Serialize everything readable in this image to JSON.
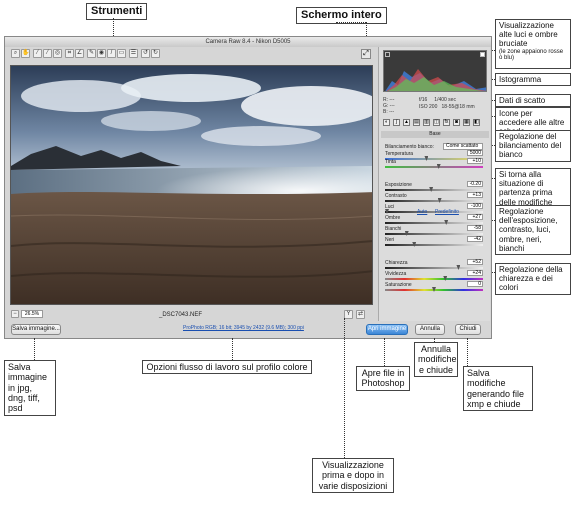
{
  "callouts": {
    "strumenti": "Strumenti",
    "schermo": "Schermo intero",
    "alte_luci": "Visualizzazione alte luci e ombre bruciate",
    "alte_luci_note": "(le zone appaiono rosse o blu)",
    "istogramma": "Istogramma",
    "dati_scatto": "Dati di scatto",
    "icone": "Icone per accedere alle altre schede",
    "bilanciamento": "Regolazione del bilanciamento del bianco",
    "torna": "Si torna alla situazione di partenza prima delle modifiche",
    "esposizione": "Regolazione dell'esposizione, contrasto, luci, ombre, neri, bianchi",
    "chiarezza": "Regolazione della chiarezza e dei colori",
    "salva": "Salva immagine in jpg, dng, tiff, psd",
    "opzioni": "Opzioni flusso di lavoro sul profilo colore",
    "apre": "Apre file in Photoshop",
    "annulla": "Annulla modifiche e chiude",
    "salva_mod": "Salva modifiche generando file xmp e chiude",
    "prima_dopo": "Visualizzazione prima e dopo in varie disposizioni"
  },
  "window": {
    "title": "Camera Raw 8.4  -  Nikon D5005",
    "zoom": "26.5%",
    "filename": "_DSC7043.NEF",
    "workflow": "ProPhoto RGB; 16 bit; 3945 by 2432 (9.6 MB); 300 ppi",
    "save_button": "Salva immagine...",
    "open_button": "Apri immagine",
    "cancel_button": "Annulla",
    "done_button": "Chiudi"
  },
  "panel": {
    "rgb": [
      "R:",
      "G:",
      "B:"
    ],
    "rgb_values": [
      "---",
      "---",
      "---"
    ],
    "shot_line1": "f/16     1/400 sec",
    "shot_line2": "ISO 200   18-55@18 mm",
    "section": "Base",
    "wb_label": "Bilanciamento bianco:",
    "wb_value": "Come scattato",
    "auto": "Auto",
    "default": "Predefinito",
    "sliders": [
      {
        "label": "Temperatura",
        "value": "5000",
        "pos": 0.42
      },
      {
        "label": "Tinta",
        "value": "+10",
        "pos": 0.55
      },
      {
        "label": "Esposizione",
        "value": "-0.20",
        "pos": 0.47
      },
      {
        "label": "Contrasto",
        "value": "+13",
        "pos": 0.56
      },
      {
        "label": "Luci",
        "value": "-100",
        "pos": 0.0
      },
      {
        "label": "Ombre",
        "value": "+27",
        "pos": 0.63
      },
      {
        "label": "Bianchi",
        "value": "-58",
        "pos": 0.21
      },
      {
        "label": "Neri",
        "value": "-42",
        "pos": 0.29
      },
      {
        "label": "Chiarezza",
        "value": "+52",
        "pos": 0.76
      },
      {
        "label": "Vividezza",
        "value": "+24",
        "pos": 0.62
      },
      {
        "label": "Saturazione",
        "value": "0",
        "pos": 0.5
      }
    ]
  }
}
